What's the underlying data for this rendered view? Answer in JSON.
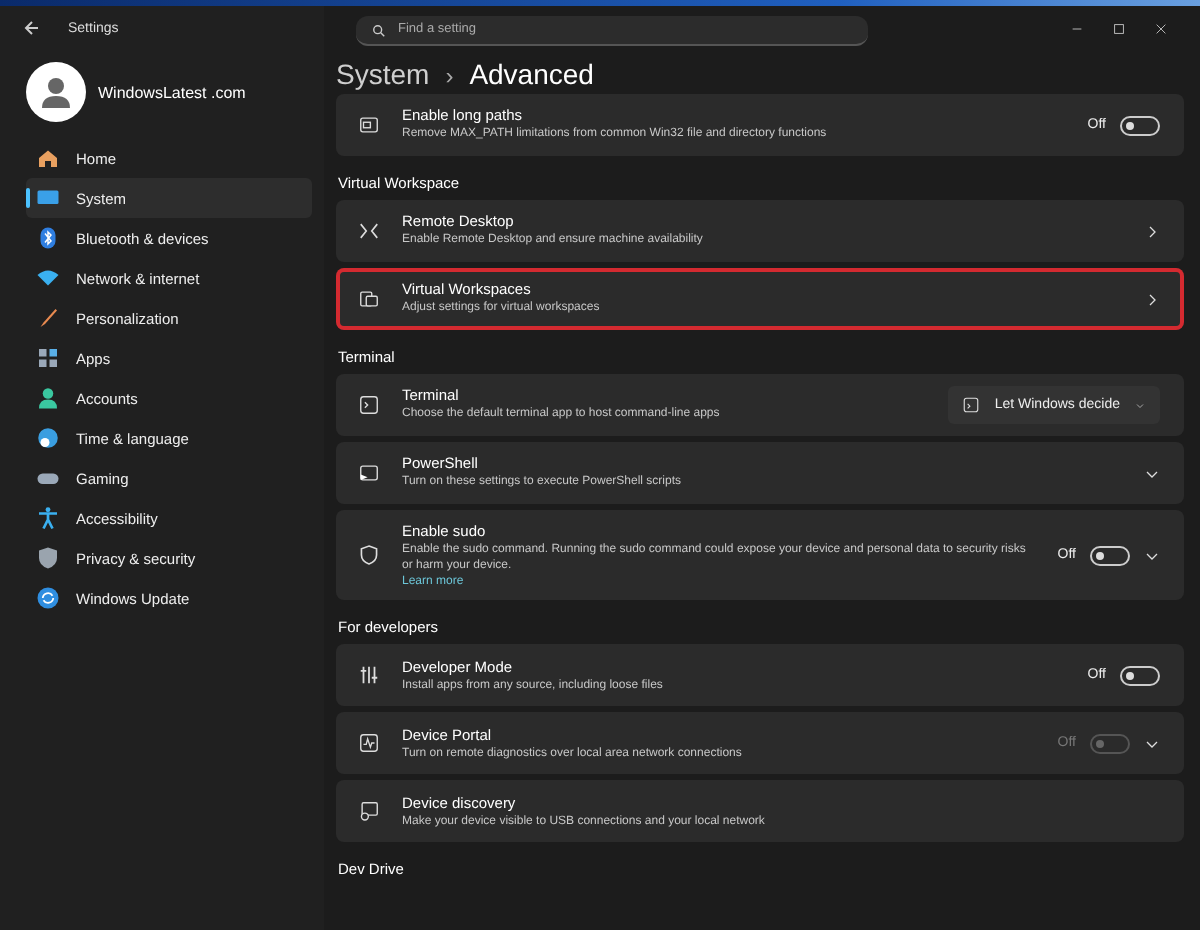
{
  "window": {
    "title": "Settings"
  },
  "account": {
    "name": "WindowsLatest .com"
  },
  "search": {
    "placeholder": "Find a setting"
  },
  "sidebar": {
    "items": [
      {
        "label": "Home",
        "selected": false
      },
      {
        "label": "System",
        "selected": true
      },
      {
        "label": "Bluetooth & devices",
        "selected": false
      },
      {
        "label": "Network & internet",
        "selected": false
      },
      {
        "label": "Personalization",
        "selected": false
      },
      {
        "label": "Apps",
        "selected": false
      },
      {
        "label": "Accounts",
        "selected": false
      },
      {
        "label": "Time & language",
        "selected": false
      },
      {
        "label": "Gaming",
        "selected": false
      },
      {
        "label": "Accessibility",
        "selected": false
      },
      {
        "label": "Privacy & security",
        "selected": false
      },
      {
        "label": "Windows Update",
        "selected": false
      }
    ]
  },
  "breadcrumb": {
    "parent": "System",
    "separator": "›",
    "current": "Advanced"
  },
  "sections": [
    {
      "items": [
        {
          "kind": "toggle",
          "title": "Enable long paths",
          "description": "Remove MAX_PATH limitations from common Win32 file and directory functions",
          "state_label": "Off",
          "on": false,
          "disabled": false,
          "highlighted": false
        }
      ]
    },
    {
      "heading": "Virtual Workspace",
      "items": [
        {
          "kind": "link",
          "title": "Remote Desktop",
          "description": "Enable Remote Desktop and ensure machine availability",
          "highlighted": false
        },
        {
          "kind": "link",
          "title": "Virtual Workspaces",
          "description": "Adjust settings for virtual workspaces",
          "highlighted": true
        }
      ]
    },
    {
      "heading": "Terminal",
      "items": [
        {
          "kind": "dropdown",
          "title": "Terminal",
          "description": "Choose the default terminal app to host command-line apps",
          "dropdown": {
            "value": "Let Windows decide"
          },
          "highlighted": false
        },
        {
          "kind": "expand",
          "title": "PowerShell",
          "description": "Turn on these settings to execute PowerShell scripts",
          "highlighted": false
        },
        {
          "kind": "toggle-expand",
          "title": "Enable sudo",
          "description": "Enable the sudo command. Running the sudo command could expose your device and personal data to security risks or harm your device.",
          "link": "Learn more",
          "state_label": "Off",
          "on": false,
          "disabled": false,
          "highlighted": false
        }
      ]
    },
    {
      "heading": "For developers",
      "items": [
        {
          "kind": "toggle",
          "title": "Developer Mode",
          "description": "Install apps from any source, including loose files",
          "state_label": "Off",
          "on": false,
          "disabled": false,
          "highlighted": false
        },
        {
          "kind": "toggle-expand",
          "title": "Device Portal",
          "description": "Turn on remote diagnostics over local area network connections",
          "state_label": "Off",
          "on": false,
          "disabled": true,
          "highlighted": false
        },
        {
          "kind": "plain",
          "title": "Device discovery",
          "description": "Make your device visible to USB connections and your local network",
          "highlighted": false
        }
      ]
    },
    {
      "heading": "Dev Drive"
    }
  ]
}
